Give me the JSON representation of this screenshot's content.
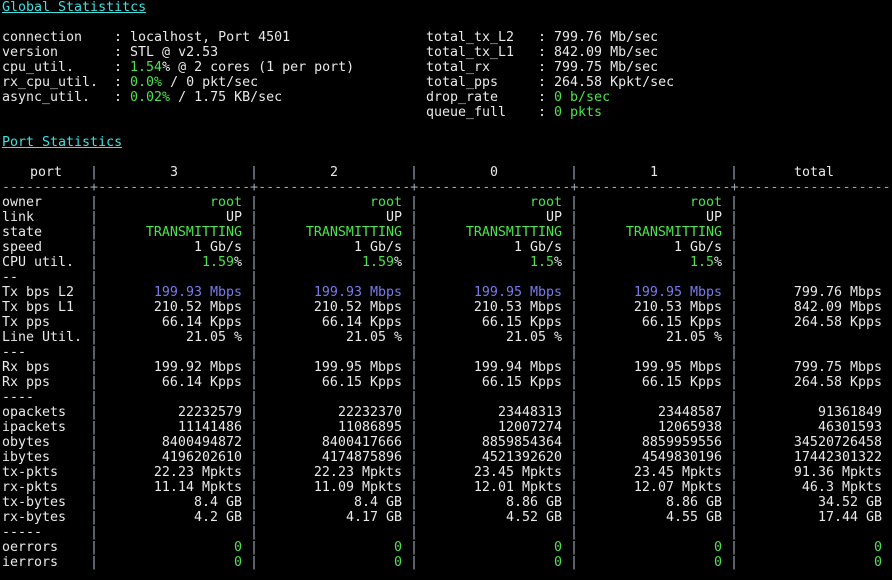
{
  "global": {
    "title": "Global Statistitcs",
    "left": [
      {
        "key": "connection",
        "value": [
          {
            "t": "localhost, Port 4501",
            "c": ""
          }
        ]
      },
      {
        "key": "version",
        "value": [
          {
            "t": "STL @ v2.53",
            "c": ""
          }
        ]
      },
      {
        "key": "cpu_util.",
        "value": [
          {
            "t": "1.54",
            "c": "green"
          },
          {
            "t": "% @ 2 cores (1 per port)",
            "c": ""
          }
        ]
      },
      {
        "key": "rx_cpu_util.",
        "value": [
          {
            "t": "0.0%",
            "c": "green"
          },
          {
            "t": " / 0 pkt/sec",
            "c": ""
          }
        ]
      },
      {
        "key": "async_util.",
        "value": [
          {
            "t": "0.02%",
            "c": "green"
          },
          {
            "t": " / 1.75 KB/sec",
            "c": ""
          }
        ]
      }
    ],
    "right": [
      {
        "key": "total_tx_L2",
        "value": [
          {
            "t": "799.76 Mb/sec",
            "c": ""
          }
        ]
      },
      {
        "key": "total_tx_L1",
        "value": [
          {
            "t": "842.09 Mb/sec",
            "c": ""
          }
        ]
      },
      {
        "key": "total_rx",
        "value": [
          {
            "t": "799.75 Mb/sec",
            "c": ""
          }
        ]
      },
      {
        "key": "total_pps",
        "value": [
          {
            "t": "264.58 Kpkt/sec",
            "c": ""
          }
        ]
      },
      {
        "key": "drop_rate",
        "value": [
          {
            "t": "0 b/sec",
            "c": "green"
          }
        ]
      },
      {
        "key": "queue_full",
        "value": [
          {
            "t": "0 pkts",
            "c": "green"
          }
        ]
      }
    ]
  },
  "ports": {
    "title": "Port Statistics",
    "header_label": "port",
    "columns": [
      "3",
      "2",
      "0",
      "1",
      "total"
    ],
    "rows": [
      {
        "label": "owner",
        "color": "green",
        "values": [
          "root",
          "root",
          "root",
          "root",
          ""
        ]
      },
      {
        "label": "link",
        "color": "",
        "values": [
          "UP",
          "UP",
          "UP",
          "UP",
          ""
        ]
      },
      {
        "label": "state",
        "color": "green",
        "values": [
          "TRANSMITTING",
          "TRANSMITTING",
          "TRANSMITTING",
          "TRANSMITTING",
          ""
        ]
      },
      {
        "label": "speed",
        "color": "",
        "values": [
          "1 Gb/s",
          "1 Gb/s",
          "1 Gb/s",
          "1 Gb/s",
          ""
        ]
      },
      {
        "label": "CPU util.",
        "color": "green",
        "suffix": "%",
        "values": [
          "1.59",
          "1.59",
          "1.5",
          "1.5",
          ""
        ]
      },
      {
        "label": "--",
        "color": "",
        "values": [
          "",
          "",
          "",
          "",
          ""
        ]
      },
      {
        "label": "Tx bps L2",
        "color": "blue",
        "total_color": "",
        "values": [
          "199.93 Mbps",
          "199.93 Mbps",
          "199.95 Mbps",
          "199.95 Mbps",
          "799.76 Mbps"
        ]
      },
      {
        "label": "Tx bps L1",
        "color": "",
        "values": [
          "210.52 Mbps",
          "210.52 Mbps",
          "210.53 Mbps",
          "210.53 Mbps",
          "842.09 Mbps"
        ]
      },
      {
        "label": "Tx pps",
        "color": "",
        "values": [
          "66.14 Kpps",
          "66.14 Kpps",
          "66.15 Kpps",
          "66.15 Kpps",
          "264.58 Kpps"
        ]
      },
      {
        "label": "Line Util.",
        "color": "",
        "values": [
          "21.05 %",
          "21.05 %",
          "21.05 %",
          "21.05 %",
          ""
        ]
      },
      {
        "label": "---",
        "color": "",
        "values": [
          "",
          "",
          "",
          "",
          ""
        ]
      },
      {
        "label": "Rx bps",
        "color": "",
        "values": [
          "199.92 Mbps",
          "199.95 Mbps",
          "199.94 Mbps",
          "199.95 Mbps",
          "799.75 Mbps"
        ]
      },
      {
        "label": "Rx pps",
        "color": "",
        "values": [
          "66.14 Kpps",
          "66.15 Kpps",
          "66.15 Kpps",
          "66.15 Kpps",
          "264.58 Kpps"
        ]
      },
      {
        "label": "----",
        "color": "",
        "values": [
          "",
          "",
          "",
          "",
          ""
        ]
      },
      {
        "label": "opackets",
        "color": "",
        "values": [
          "22232579",
          "22232370",
          "23448313",
          "23448587",
          "91361849"
        ]
      },
      {
        "label": "ipackets",
        "color": "",
        "values": [
          "11141486",
          "11086895",
          "12007274",
          "12065938",
          "46301593"
        ]
      },
      {
        "label": "obytes",
        "color": "",
        "values": [
          "8400494872",
          "8400417666",
          "8859854364",
          "8859959556",
          "34520726458"
        ]
      },
      {
        "label": "ibytes",
        "color": "",
        "values": [
          "4196202610",
          "4174875896",
          "4521392620",
          "4549830196",
          "17442301322"
        ]
      },
      {
        "label": "tx-pkts",
        "color": "",
        "values": [
          "22.23 Mpkts",
          "22.23 Mpkts",
          "23.45 Mpkts",
          "23.45 Mpkts",
          "91.36 Mpkts"
        ]
      },
      {
        "label": "rx-pkts",
        "color": "",
        "values": [
          "11.14 Mpkts",
          "11.09 Mpkts",
          "12.01 Mpkts",
          "12.07 Mpkts",
          "46.3 Mpkts"
        ]
      },
      {
        "label": "tx-bytes",
        "color": "",
        "values": [
          "8.4 GB",
          "8.4 GB",
          "8.86 GB",
          "8.86 GB",
          "34.52 GB"
        ]
      },
      {
        "label": "rx-bytes",
        "color": "",
        "values": [
          "4.2 GB",
          "4.17 GB",
          "4.52 GB",
          "4.55 GB",
          "17.44 GB"
        ]
      },
      {
        "label": "-----",
        "color": "",
        "values": [
          "",
          "",
          "",
          "",
          ""
        ]
      },
      {
        "label": "oerrors",
        "color": "green",
        "values": [
          "0",
          "0",
          "0",
          "0",
          "0"
        ]
      },
      {
        "label": "ierrors",
        "color": "green",
        "values": [
          "0",
          "0",
          "0",
          "0",
          "0"
        ]
      }
    ],
    "colors": {
      "heading": "#3ee0e0",
      "ok": "#4ee24e",
      "tx_rate": "#7a7af0"
    }
  }
}
